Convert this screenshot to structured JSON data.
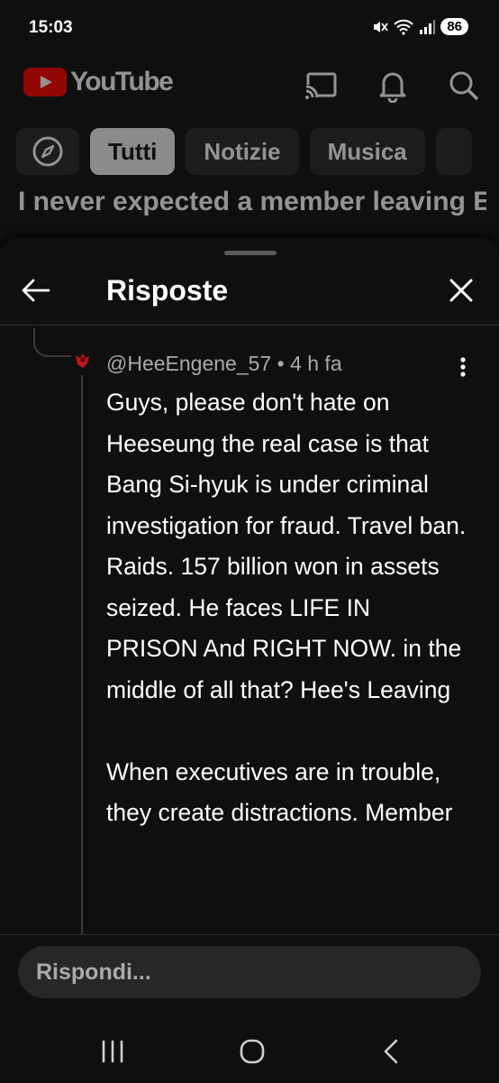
{
  "status": {
    "time": "15:03",
    "battery": "86"
  },
  "header": {
    "logo_text": "YouTube"
  },
  "chips": [
    "Tutti",
    "Notizie",
    "Musica"
  ],
  "background_comment": "I never expected a member leaving Enhypen this soon plz😭",
  "sheet": {
    "title": "Risposte"
  },
  "comment": {
    "handle": "@HeeEngene_57",
    "time": "4 h fa",
    "body": "Guys, please don't hate on Heeseung the real case is that Bang Si-hyuk is under criminal investigation for fraud. Travel ban. Raids. 157 billion won in assets seized. He faces LIFE IN PRISON And RIGHT NOW. in the middle of all that? Hee's Leaving\n\nWhen executives are in trouble, they create distractions. Member"
  },
  "reply": {
    "placeholder": "Rispondi..."
  },
  "colors": {
    "brand": "#ff0000",
    "background": "#0f0f0f",
    "chip": "#272727"
  },
  "icons": [
    "cast-icon",
    "bell-icon",
    "search-icon",
    "compass-icon",
    "back-arrow-icon",
    "close-icon",
    "more-vert-icon",
    "recents-icon",
    "home-icon",
    "back-icon"
  ]
}
